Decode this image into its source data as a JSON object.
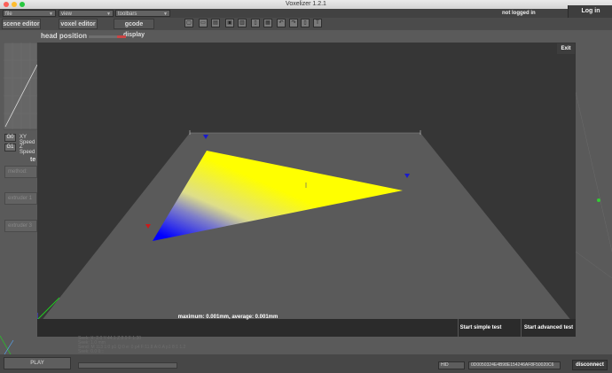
{
  "window": {
    "title": "Voxelizer 1.2.1"
  },
  "menubar": {
    "file": "file",
    "view": "view",
    "toolbars": "toolbars",
    "user_status": "not logged in",
    "login_label": "Log in"
  },
  "tabs": [
    {
      "label": "scene editor"
    },
    {
      "label": "voxel editor"
    },
    {
      "label": "gcode display"
    }
  ],
  "toolbar_icons": [
    "open-icon",
    "folder-icon",
    "save-icon",
    "export-icon",
    "folder-open-icon",
    "document-icon",
    "print-icon",
    "undo-icon",
    "redo-icon",
    "dimension-icon",
    "document-icon",
    "text-icon",
    "settings-icon"
  ],
  "side": {
    "g0": "G0",
    "g1": "G1",
    "xy_speed": "XY Speed",
    "z_speed": "Z Speed",
    "section_prefix": "te",
    "method": "method:",
    "extruder1": "extruder 1",
    "extruder3": "extruder 3"
  },
  "dialog": {
    "title": "head position",
    "exit_label": "Exit",
    "stats": "maximum: 0.001mm, average: 0.001mm",
    "simple_test_label": "Start simple test",
    "advanced_test_label": "Start advanced test"
  },
  "bottom": {
    "play_label": "PLAY",
    "port": "HID",
    "device": "0D0050324E4B98E154246AF8F50020C6",
    "disconnect_label": "disconnect",
    "log_lines": [
      "Seek: X: 2.0 Y:44.1 Z:8.9 F 1:30",
      "Seek: 1.0 mm",
      "Send: M 113 1:0 p1 Q:0 e: 0 p4 F:11.8 A:0.A p1 8:1 1.2",
      "Seek: 0.0 0:::"
    ]
  }
}
